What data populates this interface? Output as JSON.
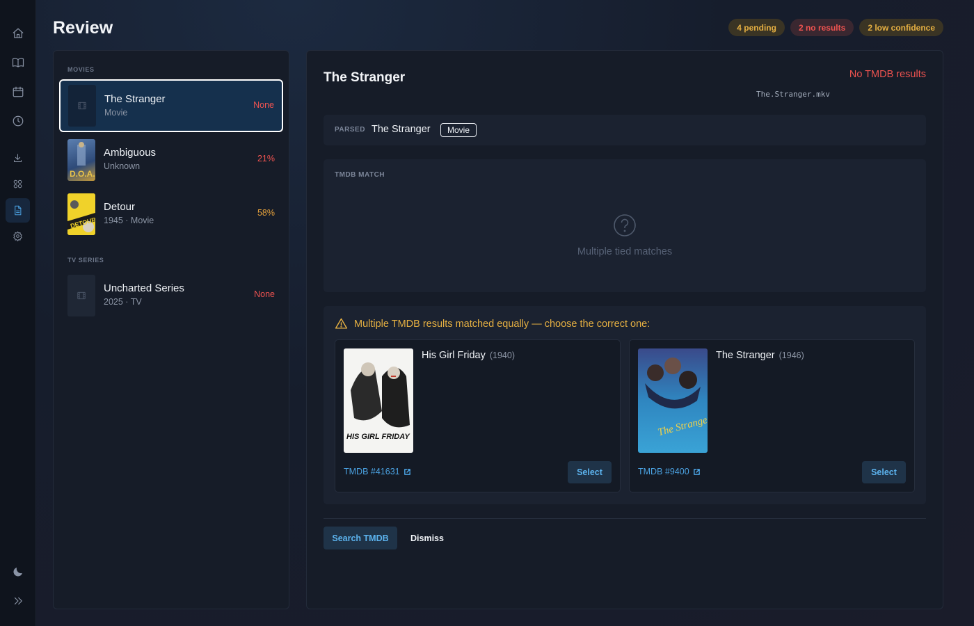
{
  "page": {
    "title": "Review"
  },
  "badges": {
    "pending": "4 pending",
    "no_results": "2 no results",
    "low_confidence": "2 low confidence"
  },
  "sidebar": {
    "icons": [
      "home-icon",
      "book-icon",
      "calendar-icon",
      "clock-icon",
      "download-icon",
      "grid-icon",
      "document-icon",
      "settings-icon",
      "moon-icon",
      "expand-icon"
    ],
    "active": "document-icon"
  },
  "list": {
    "sections": [
      {
        "label": "MOVIES",
        "items": [
          {
            "title": "The Stranger",
            "sub": "Movie",
            "status": "None",
            "selected": true
          },
          {
            "title": "Ambiguous",
            "sub": "Unknown",
            "status": "21%"
          },
          {
            "title": "Detour",
            "sub": "1945 · Movie",
            "status": "58%"
          }
        ]
      },
      {
        "label": "TV SERIES",
        "items": [
          {
            "title": "Uncharted Series",
            "sub": "2025 · TV",
            "status": "None"
          }
        ]
      }
    ]
  },
  "detail": {
    "title": "The Stranger",
    "status": "No TMDB results",
    "filename": "The.Stranger.mkv",
    "parsed": {
      "label": "PARSED",
      "title": "The Stranger",
      "type": "Movie"
    },
    "match": {
      "label": "TMDB MATCH",
      "empty_text": "Multiple tied matches"
    },
    "tie": {
      "message": "Multiple TMDB results matched equally — choose the correct one:",
      "candidates": [
        {
          "title": "His Girl Friday",
          "year": "(1940)",
          "link": "TMDB #41631",
          "select": "Select",
          "poster_text": "HIS GIRL FRIDAY"
        },
        {
          "title": "The Stranger",
          "year": "(1946)",
          "link": "TMDB #9400",
          "select": "Select",
          "poster_text": "The Stranger"
        }
      ]
    },
    "actions": {
      "search": "Search TMDB",
      "dismiss": "Dismiss"
    }
  },
  "colors": {
    "accent": "#4ba3e3",
    "error": "#ef5350",
    "warning": "#e6b042",
    "panel": "#161c28"
  }
}
